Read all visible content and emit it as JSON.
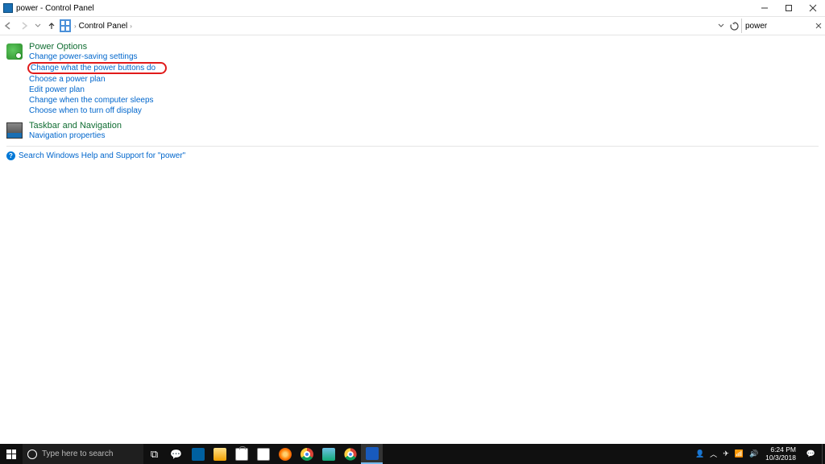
{
  "titlebar": {
    "title": "power - Control Panel"
  },
  "addr": {
    "crumb1": "Control Panel",
    "search_value": "power"
  },
  "power_options": {
    "title": "Power Options",
    "link_change_settings": "Change power-saving settings",
    "link_what_buttons": "Change what the power buttons do",
    "link_choose_plan": "Choose a power plan",
    "link_edit_plan": "Edit power plan",
    "link_when_sleeps": "Change when the computer sleeps",
    "link_turn_off_display": "Choose when to turn off display"
  },
  "taskbar_nav": {
    "title": "Taskbar and Navigation",
    "link_nav_props": "Navigation properties"
  },
  "help": {
    "text": "Search Windows Help and Support for \"power\""
  },
  "taskbar": {
    "search_placeholder": "Type here to search",
    "time": "6:24 PM",
    "date": "10/3/2018"
  }
}
